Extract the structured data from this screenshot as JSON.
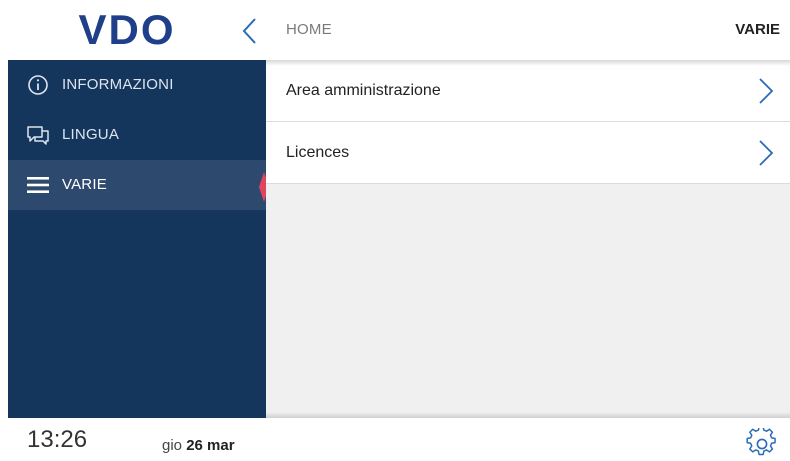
{
  "header": {
    "logo_text": "VDO",
    "breadcrumb": "HOME",
    "title": "VARIE"
  },
  "sidebar": {
    "items": [
      {
        "label": "INFORMAZIONI",
        "icon": "info-icon",
        "active": false
      },
      {
        "label": "LINGUA",
        "icon": "chat-icon",
        "active": false
      },
      {
        "label": "VARIE",
        "icon": "menu-icon",
        "active": true
      }
    ]
  },
  "main": {
    "rows": [
      {
        "label": "Area amministrazione",
        "icon": "chevron-right-icon"
      },
      {
        "label": "Licences",
        "icon": "chevron-right-icon"
      }
    ]
  },
  "status": {
    "time": "13:26",
    "day": "gio",
    "date": "26 mar"
  },
  "colors": {
    "sidebar_bg": "#15365c",
    "sidebar_active_bg": "#2d4a6e",
    "accent_blue": "#2a6bb8",
    "active_marker": "#e0455e",
    "content_bg": "#f0f0f0"
  }
}
